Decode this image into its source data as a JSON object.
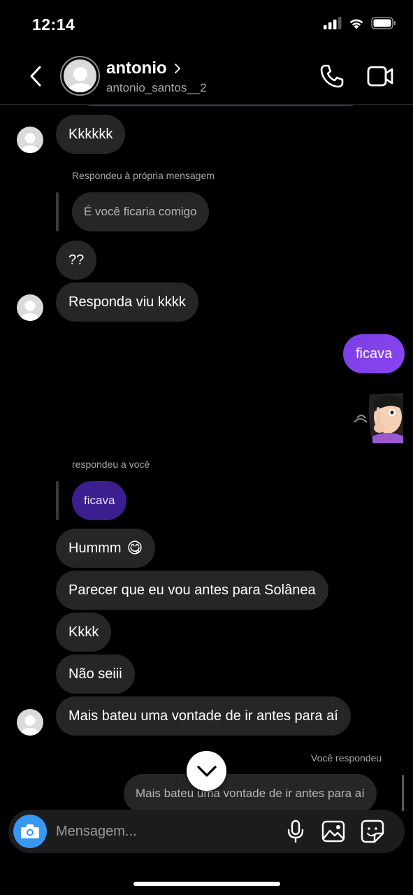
{
  "status_bar": {
    "time": "12:14"
  },
  "header": {
    "name": "antonio",
    "username": "antonio_santos__2"
  },
  "messages": {
    "m1": "Kkkkkk",
    "reply1_label": "Respondeu à própria mensagem",
    "reply1_quote": "É você ficaria comigo",
    "m2": "??",
    "m3": "Responda viu kkkk",
    "mine1": "ficava",
    "reply2_label": "respondeu a você",
    "reply2_quote": "ficava",
    "m4": "Hummm",
    "m4_emoji": "😋",
    "m5": "Parecer que eu vou antes para Solânea",
    "m6": "Kkkk",
    "m7": "Não seiii",
    "m8": "Mais bateu uma vontade de ir antes para aí",
    "reply3_label": "Você respondeu",
    "reply3_quote": "Mais bateu uma vontade de ir antes para aí"
  },
  "composer": {
    "placeholder": "Mensagem..."
  },
  "colors": {
    "my_bubble": "#7b3fe4",
    "their_bubble": "#262626",
    "camera_button": "#3897f0"
  }
}
